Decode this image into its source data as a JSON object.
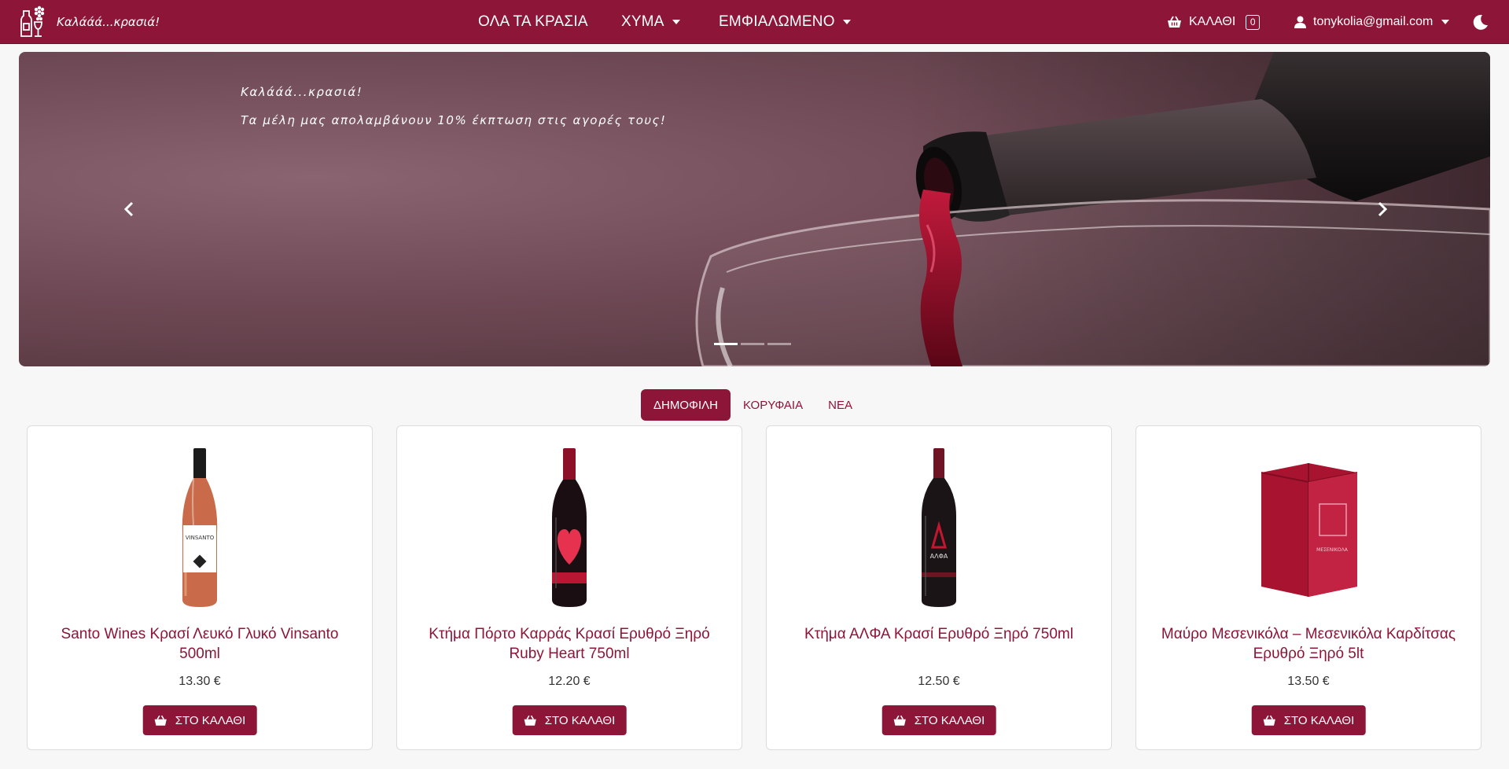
{
  "brand": {
    "name": "Καλάάά...κρασιά!",
    "logo_icon": "wine-bottle-glass-logo"
  },
  "nav": {
    "all_wines": "ΟΛΑ ΤΑ ΚΡΑΣΙΑ",
    "bulk": "ΧΥΜΑ",
    "bottled": "ΕΜΦΙΑΛΩΜΕΝΟ",
    "cart_label": "ΚΑΛΑΘΙ",
    "cart_count": "0",
    "user_email": "tonykolia@gmail.com"
  },
  "carousel": {
    "caption_line1": "Καλάάά...κρασιά!",
    "caption_line2": "Τα μέλη μας απολαμβάνουν 10% έκπτωση στις αγορές τους!",
    "slides": 3,
    "active_slide": 1
  },
  "tabs": [
    {
      "label": "ΔΗΜΟΦΙΛΗ",
      "active": true
    },
    {
      "label": "ΚΟΡΥΦΑΙΑ",
      "active": false
    },
    {
      "label": "ΝΕΑ",
      "active": false
    }
  ],
  "products": [
    {
      "title": "Santo Wines Κρασί Λευκό Γλυκό Vinsanto 500ml",
      "price": "13.30 €",
      "button": "ΣΤΟ ΚΑΛΑΘΙ",
      "image": "amber-wine-bottle"
    },
    {
      "title": "Κτήμα Πόρτο Καρράς Κρασί Ερυθρό Ξηρό Ruby Heart 750ml",
      "price": "12.20 €",
      "button": "ΣΤΟ ΚΑΛΑΘΙ",
      "image": "red-heart-wine-bottle"
    },
    {
      "title": "Κτήμα ΑΛΦΑ Κρασί Ερυθρό Ξηρό 750ml",
      "price": "12.50 €",
      "button": "ΣΤΟ ΚΑΛΑΘΙ",
      "image": "dark-red-wine-bottle"
    },
    {
      "title": "Μαύρο Μεσενικόλα – Μεσενικόλα Καρδίτσας Ερυθρό Ξηρό 5lt",
      "price": "13.50 €",
      "button": "ΣΤΟ ΚΑΛΑΘΙ",
      "image": "red-bag-in-box"
    }
  ],
  "colors": {
    "primary": "#8c1538",
    "background": "#f7f7f7"
  }
}
